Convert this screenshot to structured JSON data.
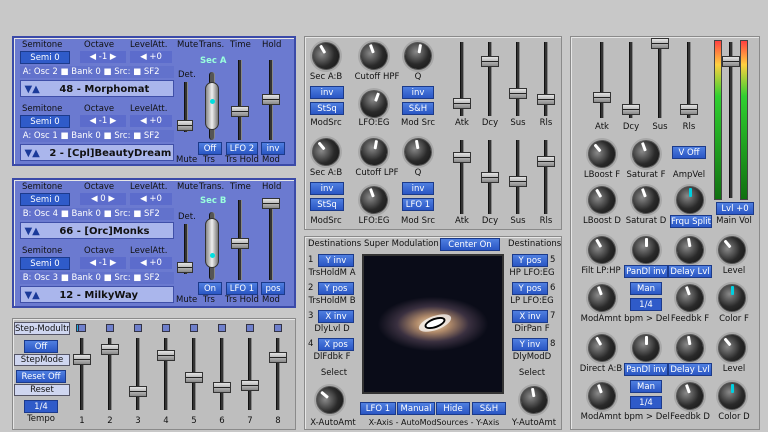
{
  "slots_a": {
    "hdr": {
      "semitone": "Semitone",
      "octave": "Octave",
      "levelatt": "LevelAtt.",
      "mute": "Mute",
      "trans": "Trans.",
      "time": "Time",
      "hold": "Hold",
      "seca": "Sec A",
      "det": "Det."
    },
    "osc2": {
      "semi": "Semi 0",
      "oct": "-1",
      "lvl": "+0",
      "line": "A: Osc 2",
      "bank": "Bank 0",
      "src": "Src:",
      "sf": "SF2",
      "preset": "48 - Morphomat"
    },
    "osc1": {
      "semi": "Semi 0",
      "oct": "-1",
      "lvl": "+0",
      "line": "A: Osc 1",
      "bank": "Bank 0",
      "src": "Src:",
      "sf": "SF2",
      "preset": "2 - [Cpl]BeautyDream"
    },
    "btns": {
      "off": "Off",
      "lfo": "LFO 2",
      "inv": "inv",
      "mute": "Mute",
      "trs": "Trs",
      "trshold": "Trs Hold",
      "mod": "Mod"
    }
  },
  "slots_b": {
    "hdr": {
      "semitone": "Semitone",
      "octave": "Octave",
      "levelatt": "LevelAtt.",
      "mute": "Mute",
      "trans": "Trans.",
      "time": "Time",
      "hold": "Hold",
      "secb": "Sec B",
      "det": "Det."
    },
    "osc4": {
      "semi": "Semi 0",
      "oct": "0",
      "lvl": "+0",
      "line": "B: Osc 4",
      "bank": "Bank 0",
      "src": "Src:",
      "sf": "SF2",
      "preset": "66 - [Orc]Monks"
    },
    "osc3": {
      "semi": "Semi 0",
      "oct": "-1",
      "lvl": "+0",
      "line": "B: Osc 3",
      "bank": "Bank 0",
      "src": "Src:",
      "sf": "SF2",
      "preset": "12 - MilkyWay"
    },
    "btns": {
      "on": "On",
      "lfo": "LFO 1",
      "pos": "pos",
      "mute": "Mute",
      "trs": "Trs",
      "trshold": "Trs Hold",
      "mod": "Mod"
    }
  },
  "step": {
    "title": "Step-Modultr",
    "off": "Off",
    "mode": "StepMode",
    "resetoff": "Reset Off",
    "reset": "Reset",
    "val": "1/4",
    "tempo": "Tempo",
    "nums": [
      "1",
      "2",
      "3",
      "4",
      "5",
      "6",
      "7",
      "8"
    ]
  },
  "filters": {
    "hpf": {
      "secab": "Sec A:B",
      "cutoff": "Cutoff HPF",
      "q": "Q",
      "inv1": "inv",
      "inv2": "inv",
      "stsq": "StSq",
      "sh": "S&H",
      "modsrc": "ModSrc",
      "lfoeg": "LFO:EG",
      "modsrc2": "Mod Src"
    },
    "lpf": {
      "secab": "Sec A:B",
      "cutoff": "Cutoff LPF",
      "q": "Q",
      "inv1": "inv",
      "inv2": "inv",
      "stsq": "StSq",
      "lfo1": "LFO 1",
      "modsrc": "ModSrc",
      "lfoeg": "LFO:EG",
      "modsrc2": "Mod Src"
    },
    "env": {
      "atk": "Atk",
      "dcy": "Dcy",
      "sus": "Sus",
      "rls": "Rls"
    }
  },
  "supermod": {
    "destL": "Destinations",
    "title": "Super Modulation",
    "center": "Center On",
    "destR": "Destinations",
    "left": [
      {
        "n": "1",
        "btn": "Y inv",
        "lbl": "TrsHoldM A"
      },
      {
        "n": "2",
        "btn": "Y pos",
        "lbl": "TrsHoldM B"
      },
      {
        "n": "3",
        "btn": "X inv",
        "lbl": "DlyLvl D"
      },
      {
        "n": "4",
        "btn": "X pos",
        "lbl": "DlFdbk F"
      }
    ],
    "right": [
      {
        "n": "5",
        "btn": "Y pos",
        "lbl": "HP LFO:EG"
      },
      {
        "n": "6",
        "btn": "Y pos",
        "lbl": "LP LFO:EG"
      },
      {
        "n": "7",
        "btn": "X inv",
        "lbl": "DirPan F"
      },
      {
        "n": "8",
        "btn": "Y inv",
        "lbl": "DlyModD"
      }
    ],
    "selectL": "Select",
    "selectR": "Select",
    "bottom": {
      "lfo": "LFO 1",
      "manual": "Manual",
      "hide": "Hide",
      "sh": "S&H"
    },
    "xamt": "X-AutoAmt",
    "axis": "X-Axis - AutoModSources - Y-Axis",
    "yamt": "Y-AutoAmt"
  },
  "master": {
    "env": {
      "atk": "Atk",
      "dcy": "Dcy",
      "sus": "Sus",
      "rls": "Rls"
    },
    "lboostf": "LBoost F",
    "saturatf": "Saturat F",
    "ampvel": "AmpVel",
    "voff": "V Off",
    "lboostd": "LBoost D",
    "saturatd": "Saturat D",
    "frqu": "Frqu Split",
    "mainvol": "Main Vol",
    "lvl": "Lvl +0",
    "row1": {
      "a": "Filt LP:HP",
      "b": "PanDl inv",
      "c": "Delay Lvl",
      "d": "Level"
    },
    "row2": {
      "a": "ModAmnt",
      "man": "Man",
      "val": "1/4",
      "b": "bpm > Del",
      "c": "Feedbk F",
      "d": "Color F"
    },
    "row3": {
      "a": "Direct A:B",
      "b": "PanDl inv",
      "c": "Delay Lvl",
      "d": "Level"
    },
    "row4": {
      "a": "ModAmnt",
      "man": "Man",
      "val": "1/4",
      "b": "bpm > Del",
      "c": "Feedbk D",
      "d": "Color D"
    }
  }
}
